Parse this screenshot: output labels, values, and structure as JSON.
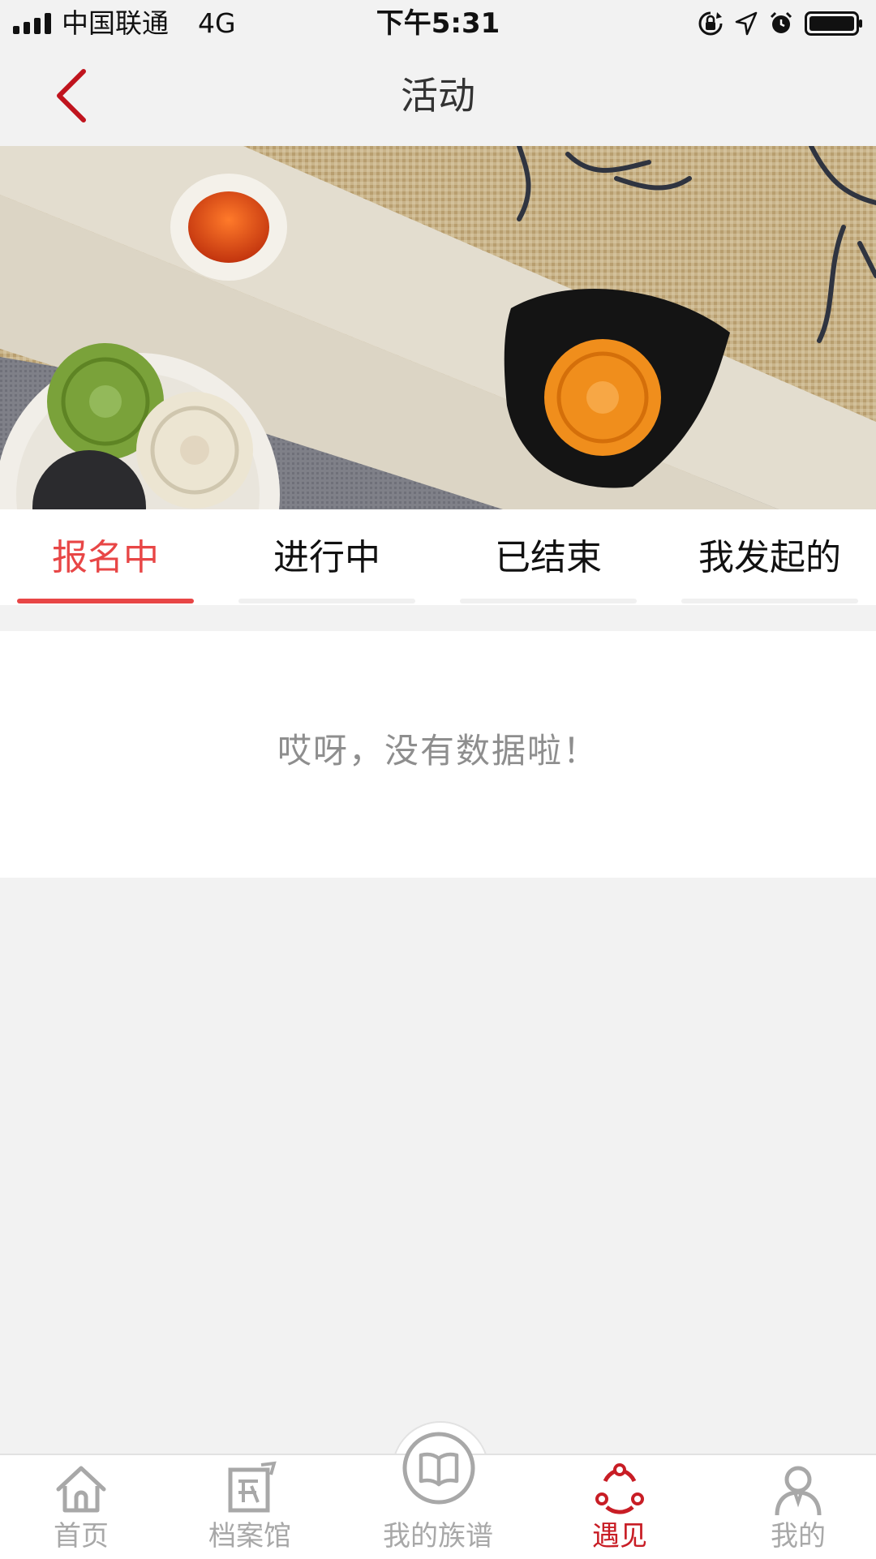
{
  "status_bar": {
    "carrier": "中国联通",
    "network": "4G",
    "time": "下午5:31"
  },
  "nav": {
    "title": "活动",
    "back_icon": "chevron-left-icon"
  },
  "banner": {
    "icon": "mooncake-banner-image"
  },
  "tabs": [
    {
      "label": "报名中",
      "active": true
    },
    {
      "label": "进行中",
      "active": false
    },
    {
      "label": "已结束",
      "active": false
    },
    {
      "label": "我发起的",
      "active": false
    }
  ],
  "content": {
    "empty_message": "哎呀，没有数据啦！"
  },
  "tab_bar": {
    "items": [
      {
        "label": "首页",
        "icon": "home-icon",
        "active": false
      },
      {
        "label": "档案馆",
        "icon": "archive-icon",
        "active": false
      },
      {
        "label": "我的族谱",
        "icon": "book-icon",
        "active": false
      },
      {
        "label": "遇见",
        "icon": "meet-icon",
        "active": true
      },
      {
        "label": "我的",
        "icon": "user-icon",
        "active": false
      }
    ]
  },
  "colors": {
    "accent": "#e84646",
    "tab_bar_active": "#c81d25",
    "back_arrow": "#c0141e",
    "inactive": "#a8a8a8",
    "background": "#f2f2f2"
  }
}
